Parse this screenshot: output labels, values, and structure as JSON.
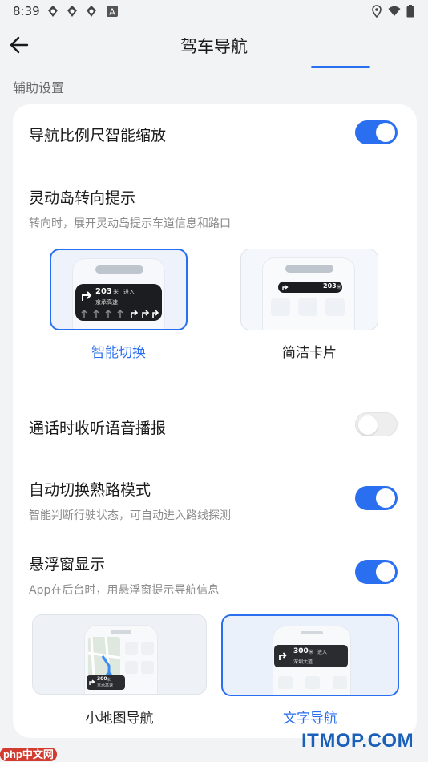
{
  "status_bar": {
    "time": "8:39",
    "left_icons": [
      "sync-icon",
      "sync-icon",
      "sync-icon",
      "a-icon"
    ],
    "right_icons": [
      "location-icon",
      "wifi-icon",
      "battery-icon"
    ]
  },
  "app_bar": {
    "title": "驾车导航",
    "back_icon": "back-arrow-icon"
  },
  "section_label": "辅助设置",
  "settings": {
    "smart_zoom": {
      "title": "导航比例尺智能缩放",
      "enabled": true
    },
    "island_turn": {
      "title": "灵动岛转向提示",
      "subtitle": "转向时，展开灵动岛提示车道信息和路口",
      "options": [
        {
          "label": "智能切换",
          "selected": true,
          "distance": "203",
          "unit": "米",
          "action": "进入",
          "road": "京承高速"
        },
        {
          "label": "简洁卡片",
          "selected": false,
          "distance": "203",
          "unit": "米"
        }
      ]
    },
    "call_voice": {
      "title": "通话时收听语音播报",
      "enabled": false
    },
    "familiar_route": {
      "title": "自动切换熟路模式",
      "subtitle": "智能判断行驶状态，可自动进入路线探测",
      "enabled": true
    },
    "floating_window": {
      "title": "悬浮窗显示",
      "subtitle": "App在后台时，用悬浮窗提示导航信息",
      "enabled": true,
      "options": [
        {
          "label": "小地图导航",
          "selected": false,
          "distance": "300",
          "unit": "米",
          "road": "京承高速"
        },
        {
          "label": "文字导航",
          "selected": true,
          "distance": "300",
          "unit": "米",
          "action": "进入",
          "road": "深圳大道"
        }
      ]
    }
  },
  "watermark": {
    "brand": "ITMOP.COM",
    "site_logo": "php中文网"
  },
  "colors": {
    "accent": "#2a6ff0",
    "background": "#f1f3f5",
    "card": "#ffffff"
  }
}
